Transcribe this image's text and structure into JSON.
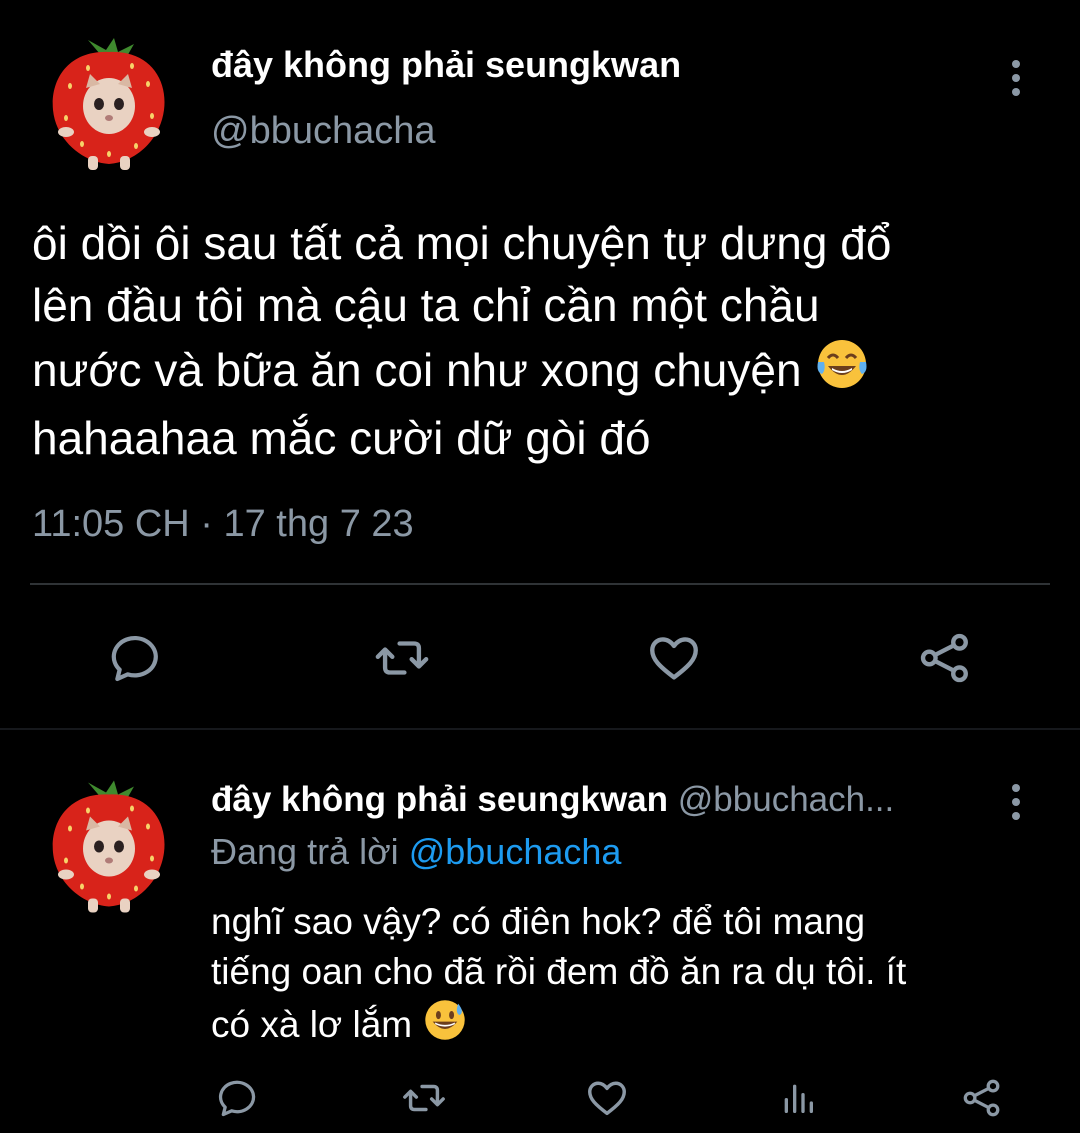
{
  "tweet": {
    "author_name": "đây không phải seungkwan",
    "author_handle": "@bbuchacha",
    "text": "ôi dồi ôi sau tất cả mọi chuyện tự dưng đổ\nlên đầu tôi mà cậu ta chỉ cần một chầu\nnước và bữa ăn coi như xong chuyện",
    "text_end": "hahaahaa mắc cười dữ gòi đó",
    "emoji": "face-with-tears-of-joy-icon",
    "timestamp": "11:05 CH · 17 thg 7 23",
    "actions": [
      "reply-icon",
      "retweet-icon",
      "like-icon",
      "share-icon"
    ]
  },
  "reply": {
    "author_name": "đây không phải seungkwan",
    "author_handle": "@bbuchach...",
    "replying_prefix": "Đang trả lời",
    "replying_to": "@bbuchacha",
    "text": "nghĩ sao vậy? có điên hok? để tôi mang\ntiếng oan cho đã rồi đem đồ ăn ra dụ tôi. ít\ncó xà lơ lắm",
    "emoji": "grinning-face-with-sweat-icon",
    "actions": [
      "reply-icon",
      "retweet-icon",
      "like-icon",
      "analytics-icon",
      "share-icon"
    ]
  },
  "colors": {
    "background": "#000000",
    "primary_text": "#ffffff",
    "secondary_text": "#8b98a5",
    "mention": "#1d9bf0",
    "divider": "#2f3336"
  }
}
